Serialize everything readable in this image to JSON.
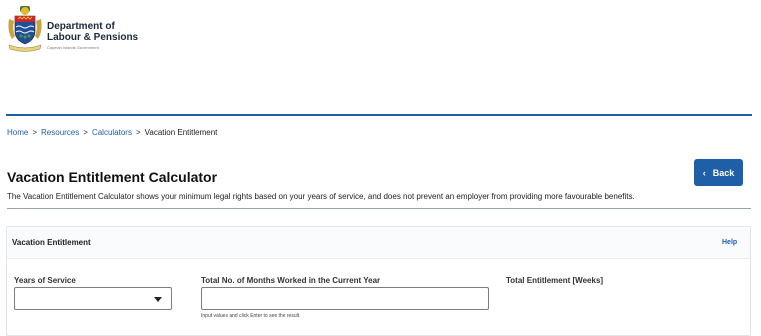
{
  "header": {
    "org_line1": "Department of",
    "org_line2": "Labour & Pensions",
    "org_sub": "Cayman Islands Government"
  },
  "breadcrumb": {
    "items": [
      "Home",
      "Resources",
      "Calculators",
      "Vacation Entitlement"
    ],
    "separator": ">"
  },
  "page": {
    "title": "Vacation Entitlement Calculator",
    "back_label": "Back",
    "back_icon": "chevron-left-icon",
    "intro": "The Vacation Entitlement Calculator shows your minimum legal rights based on your years of service, and does not prevent an employer from providing more favourable benefits."
  },
  "panel": {
    "title": "Vacation Entitlement",
    "help_label": "Help",
    "years_label": "Years of Service",
    "years_value": "",
    "months_label": "Total No. of Months Worked in the Current Year",
    "months_value": "",
    "months_hint": "Input values and click Enter to see the result.",
    "total_label": "Total Entitlement [Weeks]"
  },
  "colors": {
    "accent": "#1f5fa8",
    "link": "#1f5fa8",
    "text": "#222222"
  }
}
